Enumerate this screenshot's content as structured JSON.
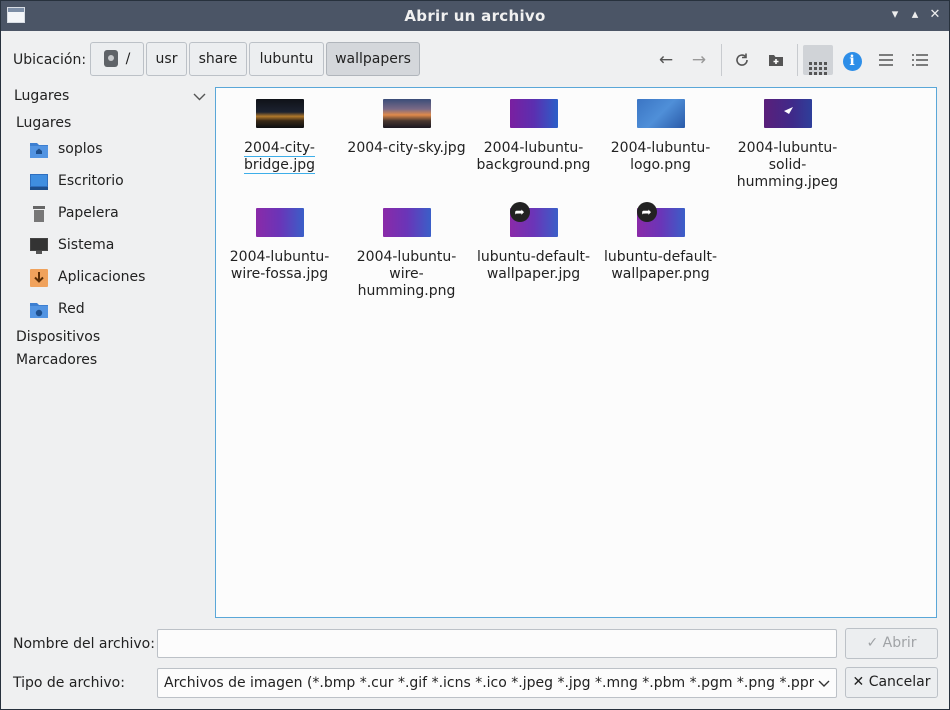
{
  "window": {
    "title": "Abrir un archivo"
  },
  "toolbar": {
    "location_label": "Ubicación:",
    "breadcrumbs": [
      "/",
      "usr",
      "share",
      "lubuntu",
      "wallpapers"
    ]
  },
  "sidebar": {
    "places_header": "Lugares",
    "places_group": "Lugares",
    "items": [
      {
        "label": "soplos",
        "icon": "home-folder-icon"
      },
      {
        "label": "Escritorio",
        "icon": "desktop-icon"
      },
      {
        "label": "Papelera",
        "icon": "trash-icon"
      },
      {
        "label": "Sistema",
        "icon": "computer-icon"
      },
      {
        "label": "Aplicaciones",
        "icon": "applications-icon"
      },
      {
        "label": "Red",
        "icon": "network-folder-icon"
      }
    ],
    "devices": "Dispositivos",
    "bookmarks": "Marcadores"
  },
  "files": [
    {
      "name": "2004-city-bridge.jpg",
      "lines": [
        "2004-city-",
        "bridge.jpg"
      ],
      "thumb": "city-night"
    },
    {
      "name": "2004-city-sky.jpg",
      "lines": [
        "2004-city-sky.jpg"
      ],
      "thumb": "city-sky"
    },
    {
      "name": "2004-lubuntu-background.png",
      "lines": [
        "2004-lubuntu-",
        "background.png"
      ],
      "thumb": "purple-blue"
    },
    {
      "name": "2004-lubuntu-logo.png",
      "lines": [
        "2004-lubuntu-",
        "logo.png"
      ],
      "thumb": "blue-logo"
    },
    {
      "name": "2004-lubuntu-solid-humming.jpeg",
      "lines": [
        "2004-lubuntu-",
        "solid-",
        "humming.jpeg"
      ],
      "thumb": "solid-purple"
    },
    {
      "name": "2004-lubuntu-wire-fossa.jpg",
      "lines": [
        "2004-lubuntu-",
        "wire-fossa.jpg"
      ],
      "thumb": "wire-purple"
    },
    {
      "name": "2004-lubuntu-wire-humming.png",
      "lines": [
        "2004-lubuntu-",
        "wire-",
        "humming.png"
      ],
      "thumb": "wire-purple"
    },
    {
      "name": "lubuntu-default-wallpaper.jpg",
      "lines": [
        "lubuntu-default-",
        "wallpaper.jpg"
      ],
      "thumb": "wire-purple",
      "symlink": true
    },
    {
      "name": "lubuntu-default-wallpaper.png",
      "lines": [
        "lubuntu-default-",
        "wallpaper.png"
      ],
      "thumb": "wire-purple",
      "symlink": true
    }
  ],
  "form": {
    "filename_label": "Nombre del archivo:",
    "filename_value": "",
    "filetype_label": "Tipo de archivo:",
    "filetype_value": "Archivos de imagen (*.bmp *.cur *.gif *.icns *.ico *.jpeg *.jpg *.mng *.pbm *.pgm *.png *.ppm *.svg",
    "open_button": "Abrir",
    "cancel_button": "Cancelar"
  }
}
